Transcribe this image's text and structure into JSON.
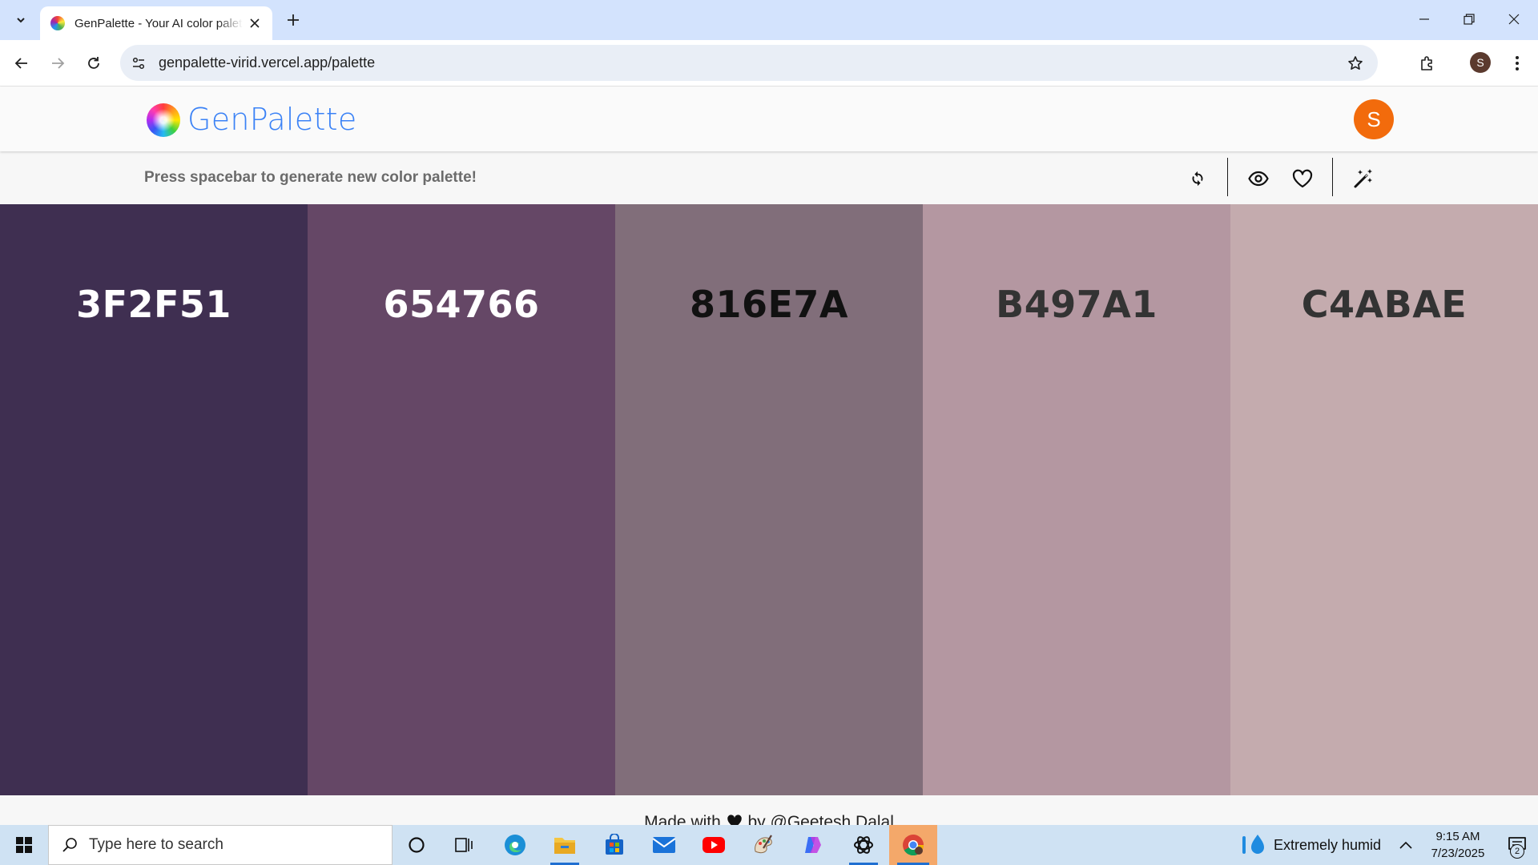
{
  "browser": {
    "tab_title": "GenPalette - Your AI color palette generator",
    "url": "genpalette-virid.vercel.app/palette",
    "profile_initial": "S"
  },
  "app": {
    "logo_text": "GenPalette",
    "avatar_initial": "S",
    "hint": "Press spacebar to generate new color palette!",
    "tools": [
      "refresh-icon",
      "eye-icon",
      "heart-icon",
      "magic-wand-icon"
    ],
    "palette": [
      {
        "hex": "3F2F51",
        "color": "#3F2F51",
        "text_color": "#ffffff"
      },
      {
        "hex": "654766",
        "color": "#654766",
        "text_color": "#ffffff"
      },
      {
        "hex": "816E7A",
        "color": "#816E7A",
        "text_color": "#111111"
      },
      {
        "hex": "B497A1",
        "color": "#B497A1",
        "text_color": "#333333"
      },
      {
        "hex": "C4ABAE",
        "color": "#C4ABAE",
        "text_color": "#333333"
      }
    ],
    "footer": {
      "prefix": "Made with",
      "suffix": "by @Geetesh Dalal"
    }
  },
  "taskbar": {
    "search_placeholder": "Type here to search",
    "weather": "Extremely humid",
    "time": "9:15 AM",
    "date": "7/23/2025",
    "notification_count": "2"
  }
}
